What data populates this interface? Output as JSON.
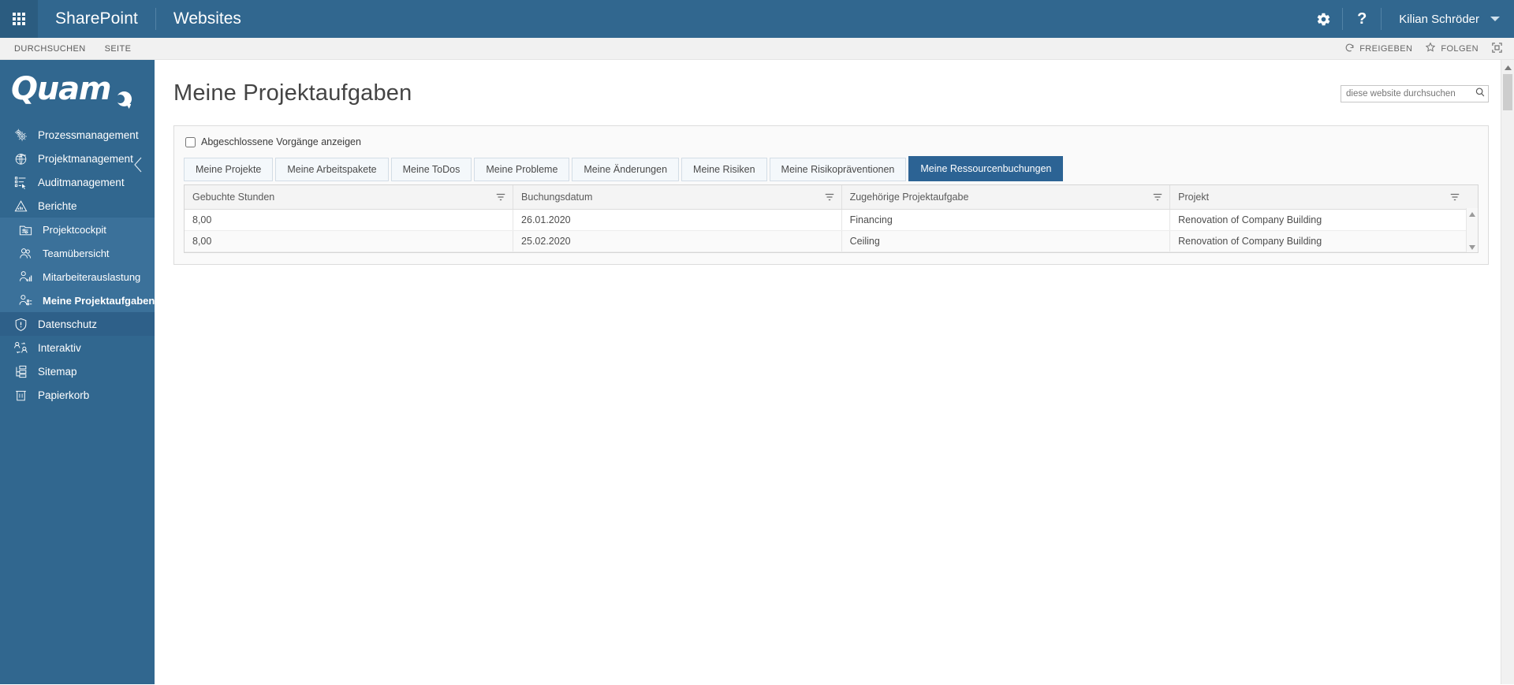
{
  "suitebar": {
    "waffle_label": "app-launcher",
    "brand": "SharePoint",
    "site": "Websites",
    "settings_icon": "gear-icon",
    "help_icon": "question-mark-icon",
    "user_name": "Kilian Schröder",
    "accent_color": "#31678F"
  },
  "ribbon": {
    "tabs": [
      {
        "label": "DURCHSUCHEN"
      },
      {
        "label": "SEITE"
      }
    ],
    "actions": [
      {
        "label": "FREIGEBEN",
        "icon": "share-icon"
      },
      {
        "label": "FOLGEN",
        "icon": "star-icon"
      }
    ],
    "focus_icon": "focus-on-content-icon"
  },
  "sidebar": {
    "logo_text": "Quam",
    "logo_mark": "quam-e-mark",
    "collapse_icon": "chevron-left-icon",
    "items": [
      {
        "label": "Prozessmanagement",
        "icon": "gears-icon",
        "level": "top"
      },
      {
        "label": "Projektmanagement",
        "icon": "globe-folder-icon",
        "level": "top"
      },
      {
        "label": "Auditmanagement",
        "icon": "checklist-cursor-icon",
        "level": "top"
      },
      {
        "label": "Berichte",
        "icon": "chart-mountain-icon",
        "level": "top"
      },
      {
        "label": "Projektcockpit",
        "icon": "dashboard-icon",
        "level": "sub"
      },
      {
        "label": "Teamübersicht",
        "icon": "people-icon",
        "level": "sub"
      },
      {
        "label": "Mitarbeiterauslastung",
        "icon": "person-chart-icon",
        "level": "sub"
      },
      {
        "label": "Meine Projektaufgaben",
        "icon": "person-tasks-icon",
        "level": "sub",
        "active": true
      },
      {
        "label": "Datenschutz",
        "icon": "shield-alert-icon",
        "level": "top",
        "highlight": true
      },
      {
        "label": "Interaktiv",
        "icon": "people-exchange-icon",
        "level": "top"
      },
      {
        "label": "Sitemap",
        "icon": "sitemap-icon",
        "level": "top"
      },
      {
        "label": "Papierkorb",
        "icon": "trash-icon",
        "level": "top"
      }
    ]
  },
  "page": {
    "title": "Meine Projektaufgaben"
  },
  "search": {
    "placeholder": "diese website durchsuchen",
    "value": "",
    "icon": "search-icon"
  },
  "webpart": {
    "checkbox_label": "Abgeschlossene Vorgänge anzeigen",
    "checkbox_checked": false,
    "tabs": [
      {
        "label": "Meine Projekte"
      },
      {
        "label": "Meine Arbeitspakete"
      },
      {
        "label": "Meine ToDos"
      },
      {
        "label": "Meine Probleme"
      },
      {
        "label": "Meine Änderungen"
      },
      {
        "label": "Meine Risiken"
      },
      {
        "label": "Meine Risikopräventionen"
      },
      {
        "label": "Meine Ressourcenbuchungen",
        "active": true
      }
    ],
    "active_tab_color": "#2C6394",
    "grid": {
      "columns": [
        {
          "label": "Gebuchte Stunden",
          "filter_icon": "filter-icon"
        },
        {
          "label": "Buchungsdatum",
          "filter_icon": "filter-icon"
        },
        {
          "label": "Zugehörige Projektaufgabe",
          "filter_icon": "filter-icon"
        },
        {
          "label": "Projekt",
          "filter_icon": "filter-icon"
        }
      ],
      "rows": [
        [
          "8,00",
          "26.01.2020",
          "Financing",
          "Renovation of Company Building"
        ],
        [
          "8,00",
          "25.02.2020",
          "Ceiling",
          "Renovation of Company Building"
        ]
      ],
      "scroll_up_icon": "caret-up-icon",
      "scroll_down_icon": "caret-down-icon"
    }
  }
}
